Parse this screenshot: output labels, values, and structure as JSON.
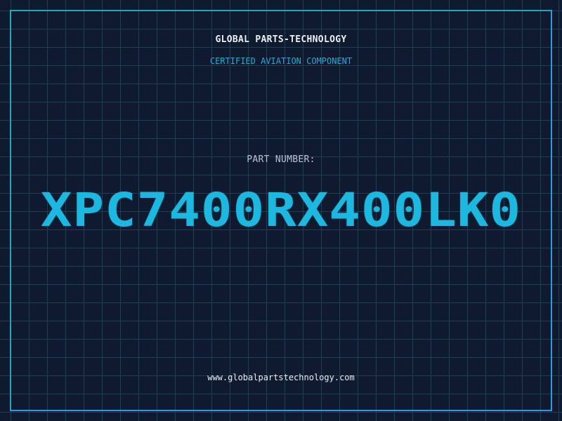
{
  "header": {
    "company": "GLOBAL PARTS-TECHNOLOGY",
    "subtitle": "CERTIFIED AVIATION COMPONENT"
  },
  "part": {
    "label": "PART NUMBER:",
    "number": "XPC7400RX400LK0"
  },
  "footer": {
    "website": "www.globalpartstechnology.com"
  },
  "colors": {
    "background": "#101a2e",
    "grid": "#1d3f56",
    "frame": "#2b9fcf",
    "accent": "#1cb8e0",
    "text": "#e8eef5"
  }
}
